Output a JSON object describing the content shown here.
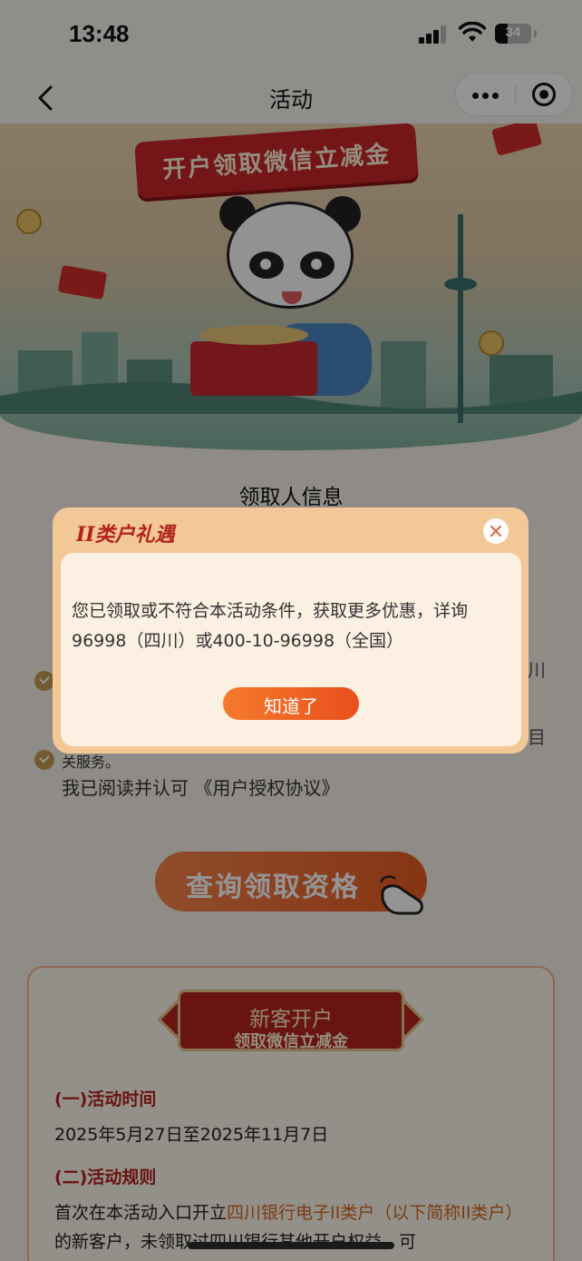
{
  "status_bar": {
    "time": "13:48",
    "battery": "34"
  },
  "nav": {
    "title": "活动"
  },
  "banner": {
    "ribbon_text": "开户领取微信立减金"
  },
  "form": {
    "section_title": "领取人信息",
    "agree_fragment": "关服务。",
    "agree_text": "我已阅读并认可",
    "agree_link": "《用户授权协议》",
    "edge_chars": [
      "川",
      "目"
    ]
  },
  "query_button": {
    "label": "查询领取资格"
  },
  "rules": {
    "badge_line1": "新客开户",
    "badge_line2": "领取微信立减金",
    "time_heading": "(一)活动时间",
    "time_text": "2025年5月27日至2025年11月7日",
    "rules_heading": "(二)活动规则",
    "rules_text_1": "首次在本活动入口开立",
    "rules_text_hl": "四川银行电子II类户（以下简称II类户）",
    "rules_text_2": "的新客户，未领取过四川银行其他开户权益，可"
  },
  "modal": {
    "title": "II类户礼遇",
    "message": "您已领取或不符合本活动条件，获取更多优惠，详询96998（四川）或400-10-96998（全国）",
    "ok_label": "知道了"
  },
  "colors": {
    "accent": "#e9501c",
    "brand_red": "#b4231e",
    "modal_bg": "#f2c996"
  }
}
